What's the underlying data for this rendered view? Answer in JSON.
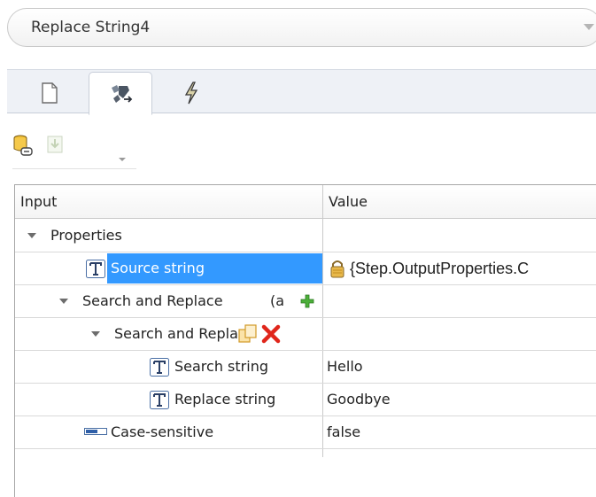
{
  "step_select": {
    "value": "Replace String4"
  },
  "tabs": [
    {
      "id": "general",
      "icon": "document-icon",
      "active": false
    },
    {
      "id": "mapping",
      "icon": "map-input-icon",
      "active": true
    },
    {
      "id": "events",
      "icon": "lightning-icon",
      "active": false
    }
  ],
  "toolbar": [
    {
      "icon": "database-link-icon",
      "enabled": true
    },
    {
      "icon": "import-icon",
      "enabled": false
    }
  ],
  "grid": {
    "columns": {
      "input": "Input",
      "value": "Value"
    },
    "rows": [
      {
        "name": "Properties",
        "value": ""
      },
      {
        "name": "Source string",
        "value": "{Step.OutputProperties.C",
        "locked": true,
        "selected": true
      },
      {
        "name": "Search and Replace",
        "suffix": "(a",
        "value": ""
      },
      {
        "name": "Search and Repla",
        "value": ""
      },
      {
        "name": "Search string",
        "value": "Hello"
      },
      {
        "name": "Replace string",
        "value": "Goodbye"
      },
      {
        "name": "Case-sensitive",
        "value": "false"
      }
    ]
  },
  "colors": {
    "selection": "#3399ff",
    "accent_add": "#3a9b2a",
    "accent_delete": "#e0261b"
  }
}
